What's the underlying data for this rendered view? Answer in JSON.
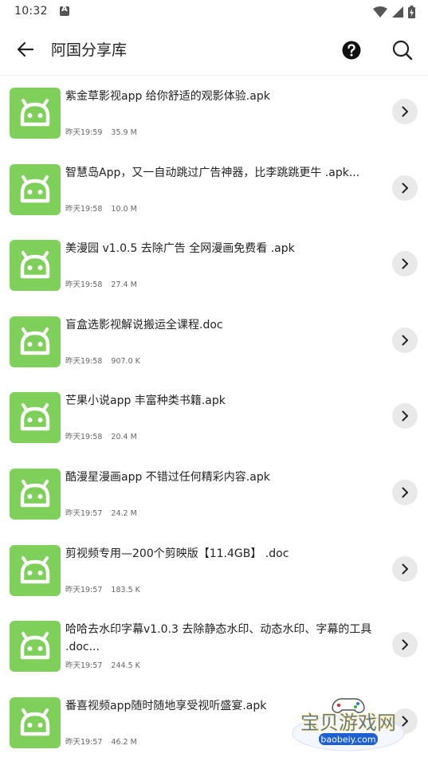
{
  "status_bar": {
    "time": "10:32",
    "icons": [
      "notification-a-icon",
      "wifi-icon",
      "signal-icon",
      "battery-icon"
    ]
  },
  "header": {
    "back_icon": "arrow-left-icon",
    "title": "阿国分享库",
    "help_icon": "help-circle-icon",
    "search_icon": "search-icon"
  },
  "files": [
    {
      "name": "紫金草影视app 给你舒适的观影体验.apk",
      "time": "昨天19:59",
      "size": "35.9 M"
    },
    {
      "name": "智慧岛App，又一自动跳过广告神器，比李跳跳更牛 .apk...",
      "time": "昨天19:58",
      "size": "10.0 M"
    },
    {
      "name": "美漫园 v1.0.5 去除广告 全网漫画免费看 .apk",
      "time": "昨天19:58",
      "size": "27.4 M"
    },
    {
      "name": "盲盒选影视解说搬运全课程.doc",
      "time": "昨天19:58",
      "size": "907.0 K"
    },
    {
      "name": "芒果小说app 丰富种类书籍.apk",
      "time": "昨天19:58",
      "size": "20.4 M"
    },
    {
      "name": "酷漫星漫画app 不错过任何精彩内容.apk",
      "time": "昨天19:57",
      "size": "24.2 M"
    },
    {
      "name": "剪视频专用—200个剪映版【11.4GB】 .doc",
      "time": "昨天19:57",
      "size": "183.5 K"
    },
    {
      "name": "哈哈去水印字幕v1.0.3 去除静态水印、动态水印、字幕的工具 .doc...",
      "time": "昨天19:57",
      "size": "244.5 K"
    },
    {
      "name": "番喜视频app随时随地享受视听盛宴.apk",
      "time": "昨天19:57",
      "size": "46.2 M"
    }
  ],
  "watermark": {
    "title": "宝贝游戏网",
    "url": "baobeiy.com"
  },
  "colors": {
    "icon_green": "#7ed05a",
    "button_gray": "#e9e9e9"
  }
}
